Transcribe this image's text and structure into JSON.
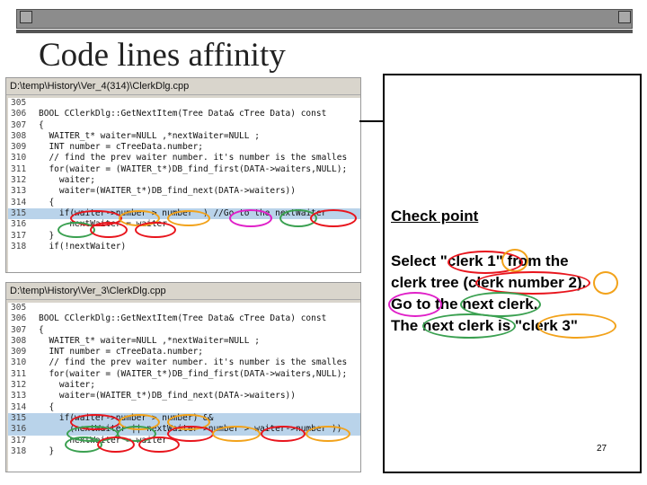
{
  "slide": {
    "title": "Code lines affinity",
    "page_number": "27"
  },
  "panels": [
    {
      "path": "D:\\temp\\History\\Ver_4(314)\\ClerkDlg.cpp",
      "lines": [
        {
          "num": "305",
          "code": ""
        },
        {
          "num": "306",
          "code": "BOOL CClerkDlg::GetNextItem(Tree Data& cTree Data) const"
        },
        {
          "num": "307",
          "code": "{"
        },
        {
          "num": "308",
          "code": "  WAITER_t* waiter=NULL ,*nextWaiter=NULL ;"
        },
        {
          "num": "309",
          "code": "  INT number = cTreeData.number;"
        },
        {
          "num": "310",
          "code": "  // find the prev waiter number. it's number is the smalles"
        },
        {
          "num": "311",
          "code": "  for(waiter = (WAITER_t*)DB_find_first(DATA->waiters,NULL);"
        },
        {
          "num": "312",
          "code": "    waiter;"
        },
        {
          "num": "313",
          "code": "    waiter=(WAITER_t*)DB_find_next(DATA->waiters))"
        },
        {
          "num": "314",
          "code": "  {"
        },
        {
          "num": "315",
          "code": "    if(waiter->number > number  ) //Go to the nextWaiter"
        },
        {
          "num": "316",
          "code": "      nextWaiter = waiter"
        },
        {
          "num": "317",
          "code": "  }"
        },
        {
          "num": "318",
          "code": "  if(!nextWaiter)"
        }
      ]
    },
    {
      "path": "D:\\temp\\History\\Ver_3\\ClerkDlg.cpp",
      "lines": [
        {
          "num": "305",
          "code": ""
        },
        {
          "num": "306",
          "code": "BOOL CClerkDlg::GetNextItem(Tree Data& cTree Data) const"
        },
        {
          "num": "307",
          "code": "{"
        },
        {
          "num": "308",
          "code": "  WAITER_t* waiter=NULL ,*nextWaiter=NULL ;"
        },
        {
          "num": "309",
          "code": "  INT number = cTreeData.number;"
        },
        {
          "num": "310",
          "code": "  // find the prev waiter number. it's number is the smalles"
        },
        {
          "num": "311",
          "code": "  for(waiter = (WAITER_t*)DB_find_first(DATA->waiters,NULL);"
        },
        {
          "num": "312",
          "code": "    waiter;"
        },
        {
          "num": "313",
          "code": "    waiter=(WAITER_t*)DB_find_next(DATA->waiters))"
        },
        {
          "num": "314",
          "code": "  {"
        },
        {
          "num": "315",
          "code": "    if(waiter->number > number) &&"
        },
        {
          "num": "316",
          "code": "      (nextWaiter || nextWaiter->number > waiter->number ))"
        },
        {
          "num": "317",
          "code": "      nextWaiter = waiter"
        },
        {
          "num": "318",
          "code": "  }"
        }
      ]
    }
  ],
  "check_point": {
    "title": "Check point",
    "lines": [
      "Select \"clerk 1\" from the",
      "clerk tree (clerk number 2).",
      "Go to the next clerk.",
      "The next clerk is \"clerk 3\""
    ]
  },
  "colors": {
    "red": "#e8141c",
    "orange": "#f2a21a",
    "magenta": "#e020c8",
    "green": "#3aa050",
    "highlight": "#b9d3ea"
  }
}
